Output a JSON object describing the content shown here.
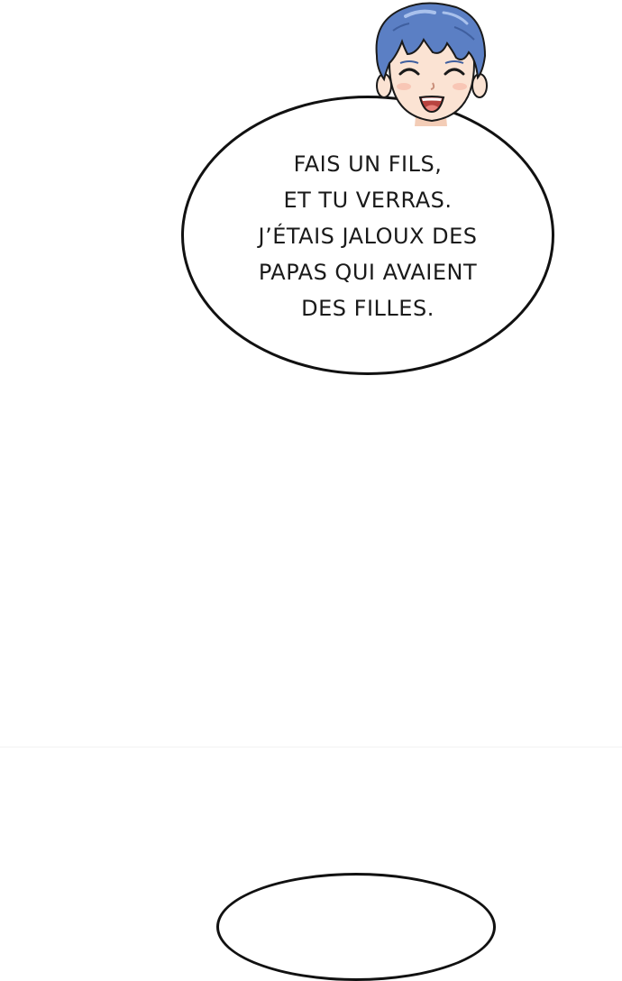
{
  "speech_bubble": {
    "lines": [
      "FAIS UN FILS,",
      "ET TU VERRAS.",
      "J’ÉTAIS JALOUX DES",
      "PAPAS QUI AVAIENT",
      "DES FILLES."
    ]
  },
  "character": {
    "icon": "smiling-boy-portrait",
    "hair_color": "#5b7fc4",
    "skin_color": "#fbe3d3"
  },
  "colors": {
    "background": "#ffffff",
    "bubble_outline": "#111111",
    "text": "#1a1a1a"
  }
}
